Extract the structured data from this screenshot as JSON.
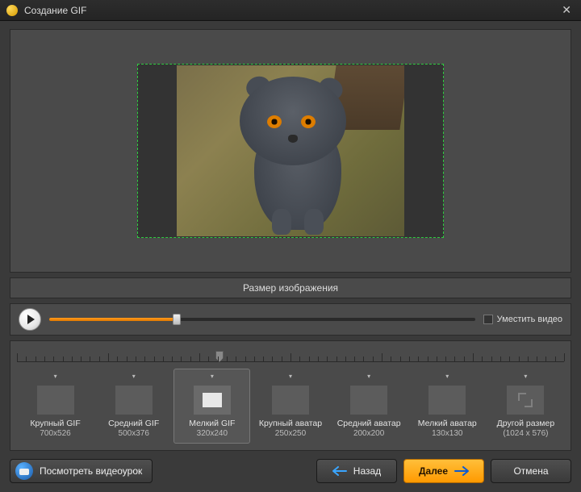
{
  "title": "Создание GIF",
  "section_label": "Размер изображения",
  "fit_label": "Уместить видео",
  "slider_percent": 30,
  "ruler_marker_percent": 37,
  "presets": [
    {
      "label": "Крупный GIF",
      "dim": "700x526",
      "thumb_w": 42,
      "thumb_h": 32,
      "selected": false,
      "icon": "rect"
    },
    {
      "label": "Средний GIF",
      "dim": "500x376",
      "thumb_w": 34,
      "thumb_h": 26,
      "selected": false,
      "icon": "rect"
    },
    {
      "label": "Мелкий GIF",
      "dim": "320x240",
      "thumb_w": 24,
      "thumb_h": 18,
      "selected": true,
      "icon": "rect"
    },
    {
      "label": "Крупный аватар",
      "dim": "250x250",
      "thumb_w": 30,
      "thumb_h": 30,
      "selected": false,
      "icon": "square"
    },
    {
      "label": "Средний аватар",
      "dim": "200x200",
      "thumb_w": 26,
      "thumb_h": 26,
      "selected": false,
      "icon": "square"
    },
    {
      "label": "Мелкий аватар",
      "dim": "130x130",
      "thumb_w": 20,
      "thumb_h": 20,
      "selected": false,
      "icon": "square"
    },
    {
      "label": "Другой размер",
      "dim": "(1024 x 576)",
      "thumb_w": 0,
      "thumb_h": 0,
      "selected": false,
      "icon": "expand"
    }
  ],
  "buttons": {
    "video_tutorial": "Посмотреть видеоурок",
    "back": "Назад",
    "next": "Далее",
    "cancel": "Отмена"
  }
}
